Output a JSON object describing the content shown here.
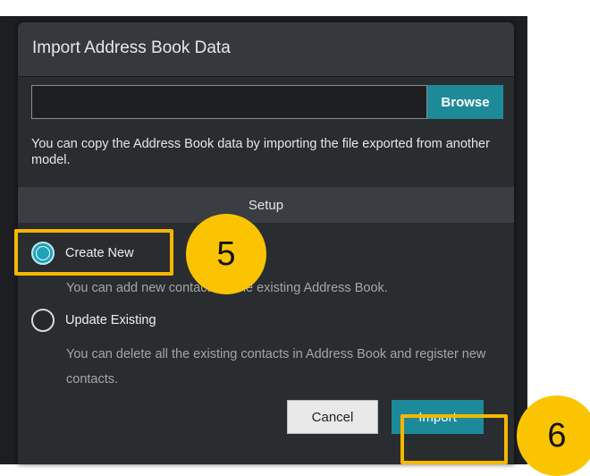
{
  "dialog": {
    "title": "Import Address Book Data",
    "file_input_value": "",
    "browse_label": "Browse",
    "description": "You can copy the Address Book data by importing the file exported from another model.",
    "setup_label": "Setup",
    "options": [
      {
        "label": "Create New",
        "description": "You can add new contacts to the existing Address Book.",
        "checked": true
      },
      {
        "label": "Update Existing",
        "description": "You can delete all the existing contacts in Address Book and register new contacts.",
        "checked": false
      }
    ],
    "cancel_label": "Cancel",
    "import_label": "Import"
  },
  "annotations": {
    "step_5": "5",
    "step_6": "6",
    "highlight_color": "#f5b700"
  },
  "colors": {
    "accent": "#1d8a99",
    "dialog_bg": "#2a2d30"
  }
}
